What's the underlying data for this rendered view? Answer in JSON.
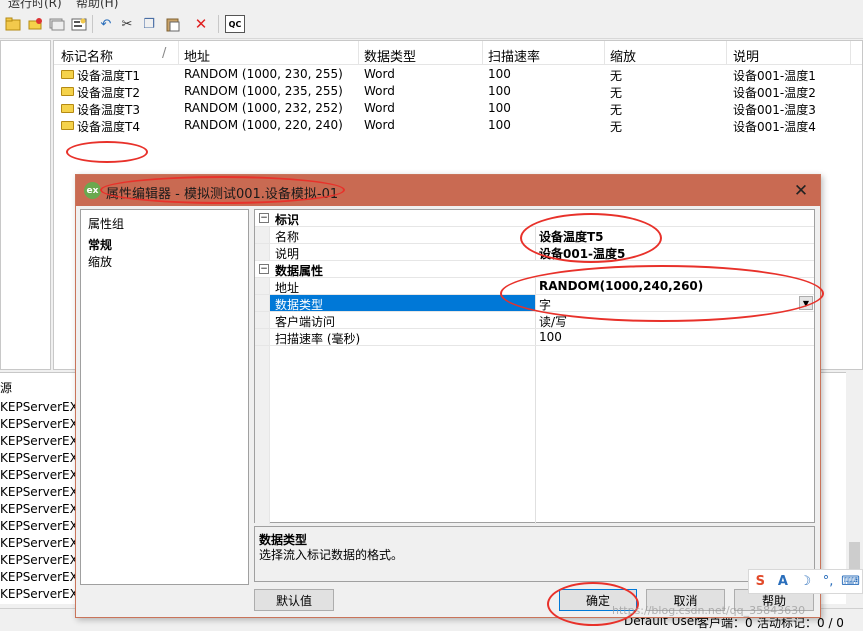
{
  "menu": {
    "items": [
      "运行时(R)",
      "帮助(H)"
    ]
  },
  "toolbar": {
    "icons": [
      "tag-folder-icon",
      "new-tag-icon",
      "tag-group-icon",
      "properties-icon",
      "undo-icon",
      "cut-icon",
      "copy-icon",
      "paste-icon",
      "delete-icon",
      "quick-client-icon"
    ],
    "glyphs": {
      "undo": "↶",
      "cut": "✂",
      "copy": "❐",
      "paste": "📋",
      "delete": "✕",
      "qc": "QC"
    }
  },
  "tag_list": {
    "columns": [
      "标记名称",
      "地址",
      "数据类型",
      "扫描速率",
      "缩放",
      "说明"
    ],
    "sort_glyph": "/",
    "rows": [
      {
        "name": "设备温度T1",
        "address": "RANDOM (1000, 230, 255)",
        "type": "Word",
        "rate": "100",
        "scale": "无",
        "desc": "设备001-温度1"
      },
      {
        "name": "设备温度T2",
        "address": "RANDOM (1000, 235, 255)",
        "type": "Word",
        "rate": "100",
        "scale": "无",
        "desc": "设备001-温度2"
      },
      {
        "name": "设备温度T3",
        "address": "RANDOM (1000, 232, 252)",
        "type": "Word",
        "rate": "100",
        "scale": "无",
        "desc": "设备001-温度3"
      },
      {
        "name": "设备温度T4",
        "address": "RANDOM (1000, 220, 240)",
        "type": "Word",
        "rate": "100",
        "scale": "无",
        "desc": "设备001-温度4"
      }
    ]
  },
  "event_log": {
    "header": "源",
    "rows": [
      "KEPServerEX\\R",
      "KEPServerEX\\R",
      "KEPServerEX\\R",
      "KEPServerEX\\R",
      "KEPServerEX\\R",
      "KEPServerEX\\R",
      "KEPServerEX\\R",
      "KEPServerEX\\R",
      "KEPServerEX\\R",
      "KEPServerEX\\R",
      "KEPServerEX\\R",
      "KEPServerEX\\R"
    ]
  },
  "status": {
    "user": "Default User",
    "clients": "客户端：0",
    "active_tags": "活动标记：0 / 0"
  },
  "dialog": {
    "logo": "ex",
    "title": "属性编辑器 - 模拟测试001.设备模拟-01",
    "close_glyph": "✕",
    "groups_header": "属性组",
    "groups": [
      "常规",
      "缩放"
    ],
    "categories": [
      {
        "label": "标识",
        "toggle": "−",
        "props": [
          {
            "name": "名称",
            "value": "设备温度T5"
          },
          {
            "name": "说明",
            "value": "设备001-温度5"
          }
        ]
      },
      {
        "label": "数据属性",
        "toggle": "−",
        "props": [
          {
            "name": "地址",
            "value": "RANDOM(1000,240,260)"
          },
          {
            "name": "数据类型",
            "value": "字"
          },
          {
            "name": "客户端访问",
            "value": "读/写"
          },
          {
            "name": "扫描速率 (毫秒)",
            "value": "100"
          }
        ]
      }
    ],
    "dropdown_glyph": "▼",
    "description": {
      "title": "数据类型",
      "text": "选择流入标记数据的格式。"
    },
    "buttons": {
      "defaults": "默认值",
      "ok": "确定",
      "cancel": "取消",
      "help": "帮助"
    }
  },
  "ime": {
    "items": [
      "S",
      "A",
      "☽",
      "°,",
      "⌨"
    ]
  },
  "watermark": "https://blog.csdn.net/qq_35843630"
}
